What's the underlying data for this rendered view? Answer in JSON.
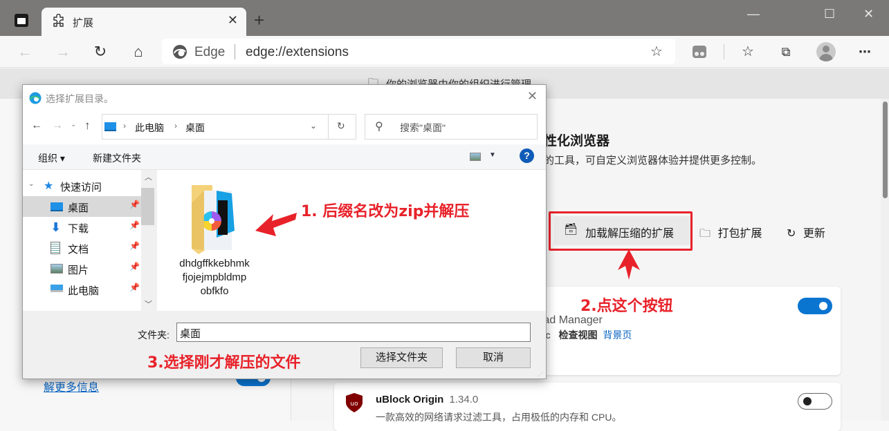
{
  "browser": {
    "tab": {
      "label": "扩展",
      "icon": "puzzle-icon"
    },
    "new_tab_label": "+",
    "window_controls": {
      "minimize": "—",
      "maximize": "☐",
      "close": "✕"
    },
    "address": {
      "brand": "Edge",
      "url": "edge://extensions"
    },
    "toolbar_icons": [
      "back-icon",
      "forward-icon",
      "refresh-icon",
      "home-icon",
      "add-favorite-icon",
      "extensions-icon",
      "favorites-icon",
      "collections-icon",
      "profile-icon",
      "more-icon"
    ]
  },
  "page": {
    "managed_notice": "你的浏览器由你的组织进行管理",
    "heading_partial": "性化浏览器",
    "description_partial": "的工具，可自定义浏览器体验并提供更多控制。",
    "learn_more_partial": "解更多信息",
    "actions": {
      "load_unpacked": "加载解压缩的扩展",
      "pack": "打包扩展",
      "update": "更新"
    },
    "extensions": [
      {
        "name_partial": "load Manager",
        "meta_partial": "pec",
        "inspect_label": "检查视图",
        "bg_link": "背景页",
        "enabled": true
      },
      {
        "name": "uBlock Origin",
        "version": "1.34.0",
        "description": "一款高效的网络请求过滤工具，占用极低的内存和 CPU。",
        "enabled": false
      }
    ]
  },
  "dialog": {
    "title": "选择扩展目录。",
    "breadcrumb": [
      "此电脑",
      "桌面"
    ],
    "search_placeholder": "搜索\"桌面\"",
    "toolbar": {
      "organize": "组织 ▾",
      "new_folder": "新建文件夹"
    },
    "tree": [
      {
        "label": "快速访问",
        "icon": "star-icon",
        "header": true
      },
      {
        "label": "桌面",
        "icon": "desktop-icon",
        "selected": true
      },
      {
        "label": "下载",
        "icon": "download-icon"
      },
      {
        "label": "文档",
        "icon": "document-icon"
      },
      {
        "label": "图片",
        "icon": "picture-icon"
      },
      {
        "label": "此电脑",
        "icon": "computer-icon"
      }
    ],
    "files": [
      {
        "name": "dhdgffkkebhmkfjojejmpbldmpobfkfo",
        "lines": [
          "dhdgffkkebhmk",
          "fjojejmpbldmp",
          "obfkfo"
        ]
      }
    ],
    "folder_label": "文件夹:",
    "folder_value": "桌面",
    "select_button": "选择文件夹",
    "cancel_button": "取消"
  },
  "annotations": {
    "step1": "1. 后缀名改为zip并解压",
    "step2": "2.点这个按钮",
    "step3": "3.选择刚才解压的文件",
    "color": "#e8222a"
  }
}
